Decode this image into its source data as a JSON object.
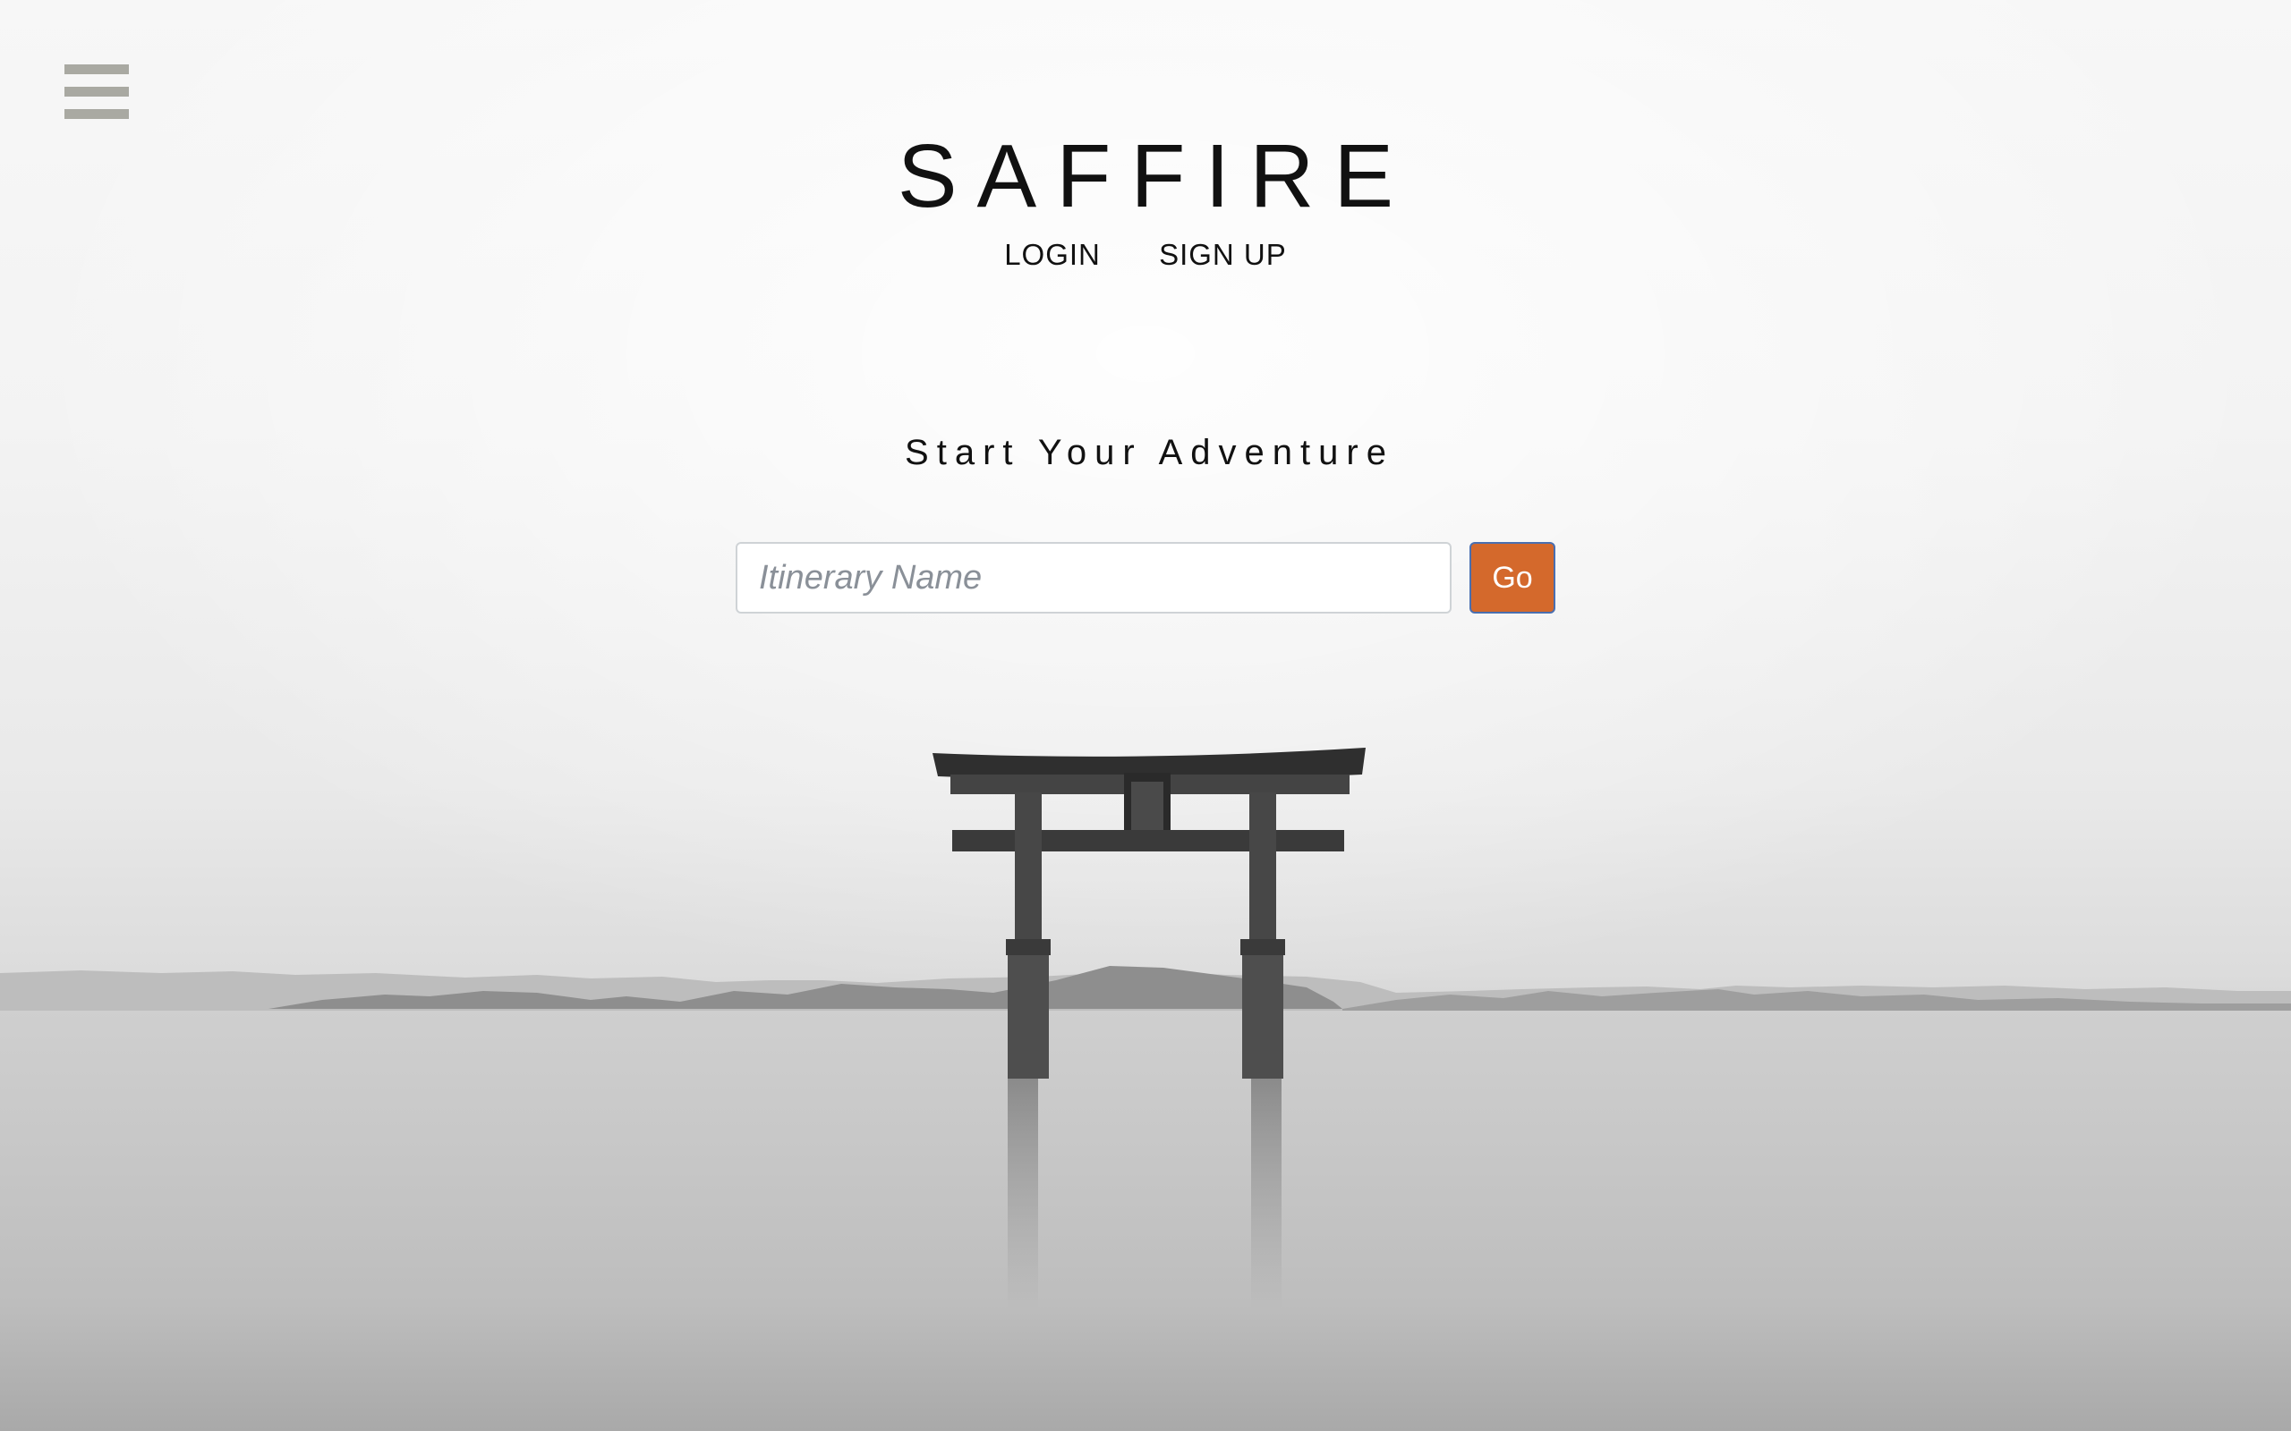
{
  "header": {
    "menu_icon": "hamburger-menu-icon",
    "brand": "SAFFIRE",
    "login_label": "LOGIN",
    "signup_label": "SIGN UP"
  },
  "hero": {
    "tagline": "Start Your Adventure",
    "background": "torii-gate-lake-photo"
  },
  "search": {
    "placeholder": "Itinerary Name",
    "value": "",
    "go_label": "Go"
  },
  "colors": {
    "accent": "#d4692c",
    "go_border": "#4a6fb0",
    "menu_icon": "#a9a9a2",
    "text": "#111111"
  }
}
